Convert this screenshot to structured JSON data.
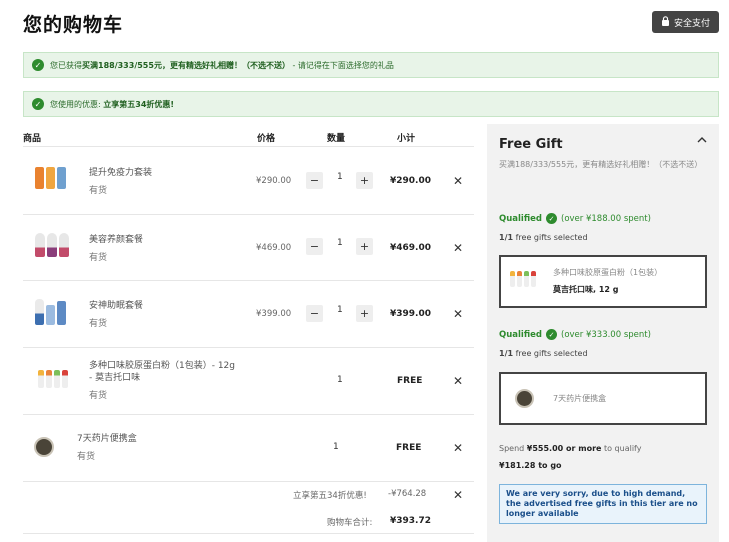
{
  "page": {
    "title": "您的购物车",
    "secure_label": "安全支付"
  },
  "banners": [
    {
      "prefix": "您已获得",
      "bold": "买满188/333/555元，更有精选好礼相赠！（不选不送）",
      "suffix": " - 请记得在下面选择您的礼品"
    },
    {
      "prefix": "您使用的优惠:",
      "bold": "立享第五34折优惠!"
    }
  ],
  "table": {
    "headers": {
      "product": "商品",
      "price": "价格",
      "qty": "数量",
      "subtotal": "小计"
    },
    "items": [
      {
        "name": "提升免疫力套装",
        "stock": "有货",
        "price": "¥290.00",
        "qty": "1",
        "subtotal": "¥290.00",
        "editable": true
      },
      {
        "name": "美容养颜套餐",
        "stock": "有货",
        "price": "¥469.00",
        "qty": "1",
        "subtotal": "¥469.00",
        "editable": true
      },
      {
        "name": "安神助眠套餐",
        "stock": "有货",
        "price": "¥399.00",
        "qty": "1",
        "subtotal": "¥399.00",
        "editable": true
      },
      {
        "name": "多种口味胶原蛋白粉（1包装）- 12g - 莫吉托口味",
        "stock": "有货",
        "price": "",
        "qty": "1",
        "subtotal": "FREE",
        "editable": false
      },
      {
        "name": "7天药片便携盒",
        "stock": "有货",
        "price": "",
        "qty": "1",
        "subtotal": "FREE",
        "editable": false
      }
    ]
  },
  "summary": {
    "discount_label": "立享第五34折优惠!",
    "discount_value": "-¥764.28",
    "total_label": "购物车合计:",
    "total_value": "¥393.72"
  },
  "gift_panel": {
    "title": "Free Gift",
    "description": "买满188/333/555元，更有精选好礼相赠！（不选不送）",
    "tiers": [
      {
        "qualified": "Qualified",
        "spent": "(over ¥188.00 spent)",
        "count_bold": "1/1",
        "count_text": " free gifts selected",
        "gift_name": "多种口味胶原蛋白粉（1包装）",
        "gift_variant": "莫吉托口味, 12 g"
      },
      {
        "qualified": "Qualified",
        "spent": "(over ¥333.00 spent)",
        "count_bold": "1/1",
        "count_text": " free gifts selected",
        "gift_name": "7天药片便携盒"
      }
    ],
    "next": {
      "prefix": "Spend ",
      "amount": "¥555.00 or more",
      "suffix": " to qualify",
      "remaining": "¥181.28 to go"
    },
    "alert": "We are very sorry, due to high demand, the advertised free gifts in this tier are no longer available"
  },
  "colors": {
    "accent_green": "#2e8b2e",
    "banner_bg": "#e8f4e8",
    "panel_bg": "#f2f2f2",
    "alert_blue": "#1b4f8a"
  },
  "icons": {
    "secure": "lock-icon",
    "check": "check-circle-icon",
    "remove": "close-icon",
    "collapse": "chevron-up-icon"
  }
}
